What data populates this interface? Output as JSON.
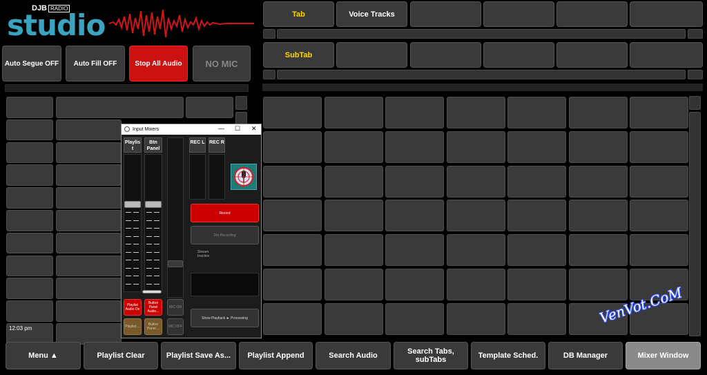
{
  "logo": {
    "brand": "DJB",
    "sub": "RADIO",
    "name": "studio"
  },
  "controls": {
    "auto_segue": "Auto Segue OFF",
    "auto_fill": "Auto Fill OFF",
    "stop_all": "Stop All Audio",
    "no_mic": "NO MIC"
  },
  "tabs": {
    "tab": "Tab",
    "voice_tracks": "Voice Tracks",
    "subtab": "SubTab"
  },
  "clock": {
    "time": "12:03 pm"
  },
  "mixer": {
    "title": "Input Mixers",
    "ch_playlist": "Playlis t",
    "ch_btn_panel": "Btn Panel",
    "rec_l": "REC L",
    "rec_r": "REC R",
    "record": "Record",
    "dm_recording": "Dm Recording",
    "stream_label": "Stream Inactive",
    "playlist_audio_on": "Playlist Audio On",
    "btn_panel_audio": "Button Panel Audio...",
    "mic_on": "MIC ON",
    "mic_off": "MIC OFF",
    "show_playback": "Show Playback ► Processing",
    "playlist_brown": "Playlist ...",
    "btn_panel_brown": "Button Panel ..."
  },
  "bottom": {
    "menu": "Menu ▲",
    "playlist_clear": "Playlist Clear",
    "playlist_save_as": "Playlist Save As...",
    "playlist_append": "Playlist Append",
    "search_audio": "Search Audio",
    "search_tabs": "Search Tabs, subTabs",
    "template_sched": "Template Sched.",
    "db_manager": "DB Manager",
    "mixer_window": "Mixer Window"
  },
  "watermark": "VenVot.CoM",
  "colors": {
    "accent_red": "#cc1111",
    "logo_blue": "#3aa3c0",
    "tab_text": "#ffd700"
  }
}
